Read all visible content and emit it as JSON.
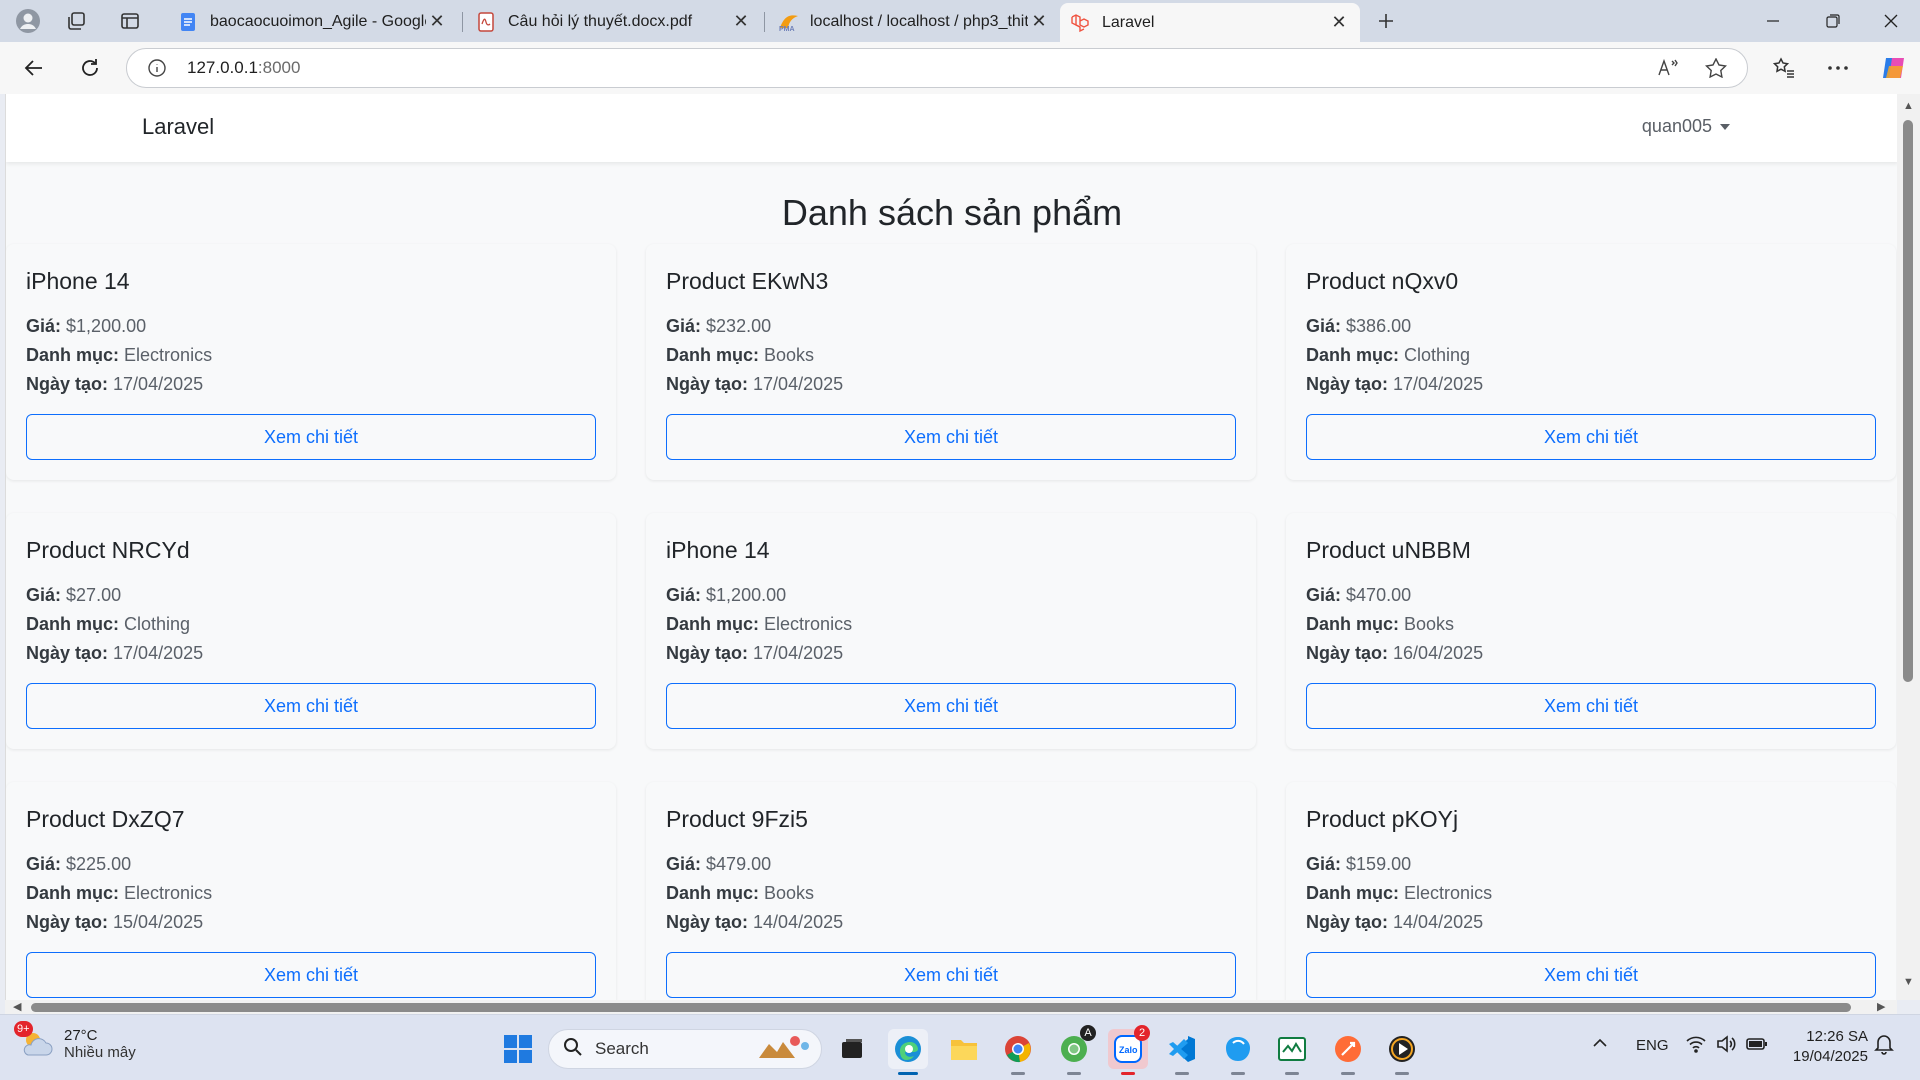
{
  "browser": {
    "tabs": [
      {
        "title": "baocaocuoimon_Agile - Google T",
        "favicon": "google-docs-icon"
      },
      {
        "title": "Câu hỏi lý thuyết.docx.pdf",
        "favicon": "pdf-icon"
      },
      {
        "title": "localhost / localhost / php3_thith",
        "favicon": "phpmyadmin-icon"
      },
      {
        "title": "Laravel",
        "favicon": "laravel-icon",
        "active": true
      }
    ],
    "address": {
      "host": "127.0.0.1",
      "port": ":8000"
    }
  },
  "navbar": {
    "brand": "Laravel",
    "user": "quan005"
  },
  "page": {
    "title": "Danh sách sản phẩm"
  },
  "labels": {
    "price": "Giá:",
    "category": "Danh mục:",
    "created": "Ngày tạo:",
    "detail_button": "Xem chi tiết"
  },
  "products": [
    {
      "name": "iPhone 14",
      "price": "$1,200.00",
      "category": "Electronics",
      "created": "17/04/2025"
    },
    {
      "name": "Product EKwN3",
      "price": "$232.00",
      "category": "Books",
      "created": "17/04/2025"
    },
    {
      "name": "Product nQxv0",
      "price": "$386.00",
      "category": "Clothing",
      "created": "17/04/2025"
    },
    {
      "name": "Product NRCYd",
      "price": "$27.00",
      "category": "Clothing",
      "created": "17/04/2025"
    },
    {
      "name": "iPhone 14",
      "price": "$1,200.00",
      "category": "Electronics",
      "created": "17/04/2025"
    },
    {
      "name": "Product uNBBM",
      "price": "$470.00",
      "category": "Books",
      "created": "16/04/2025"
    },
    {
      "name": "Product DxZQ7",
      "price": "$225.00",
      "category": "Electronics",
      "created": "15/04/2025"
    },
    {
      "name": "Product 9Fzi5",
      "price": "$479.00",
      "category": "Books",
      "created": "14/04/2025"
    },
    {
      "name": "Product pKOYj",
      "price": "$159.00",
      "category": "Electronics",
      "created": "14/04/2025"
    }
  ],
  "taskbar": {
    "weather": {
      "temp": "27°C",
      "desc": "Nhiều mây",
      "badge": "9+"
    },
    "search_label": "Search",
    "zalo_badge": "2",
    "lang": "ENG",
    "time": "12:26 SA",
    "date": "19/04/2025"
  },
  "colors": {
    "accent": "#0d6efd",
    "tabstrip": "#d3dae6",
    "taskbar": "#dde3f1"
  }
}
